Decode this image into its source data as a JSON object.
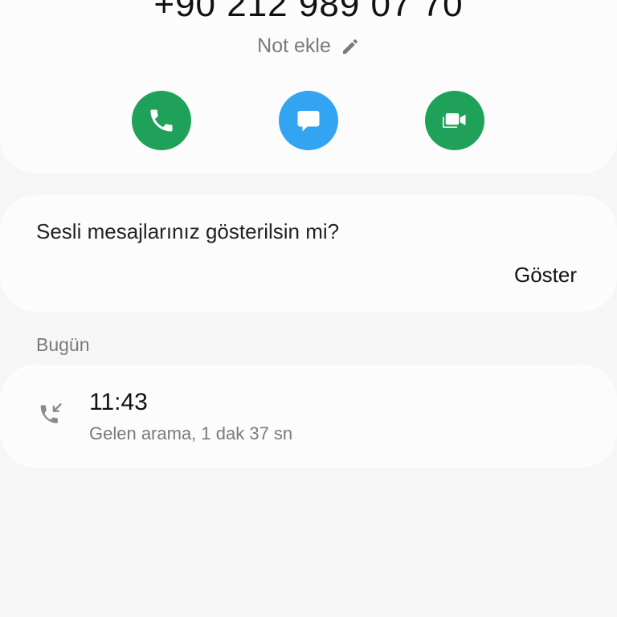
{
  "contact": {
    "phone_number": "+90 212 989 07 70",
    "note_label": "Not ekle"
  },
  "actions": {
    "call_color": "#1fa15a",
    "message_color": "#33a4f2",
    "video_color": "#1fa15a"
  },
  "voicemail": {
    "question": "Sesli mesajlarınız gösterilsin mi?",
    "show_label": "Göster"
  },
  "history": {
    "section_label": "Bugün",
    "entries": [
      {
        "time": "11:43",
        "detail": "Gelen arama, 1 dak 37 sn",
        "icon": "incoming-call-icon"
      }
    ]
  }
}
